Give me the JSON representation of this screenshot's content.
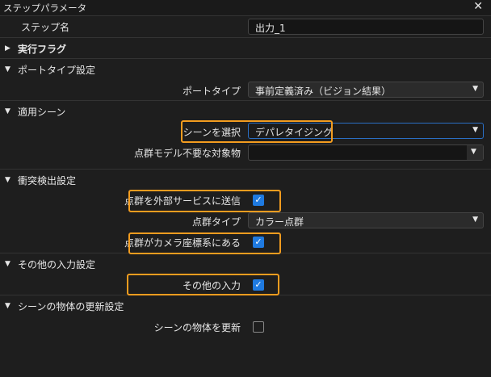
{
  "title": "ステップパラメータ",
  "step_name": {
    "label": "ステップ名",
    "value": "出力_1"
  },
  "exec_flag": "実行フラグ",
  "port_section": {
    "title": "ポートタイプ設定",
    "label": "ポートタイプ",
    "value": "事前定義済み（ビジョン結果）"
  },
  "scene_section": {
    "title": "適用シーン",
    "select_label": "シーンを選択",
    "select_value": "デパレタイジング",
    "unneeded_label": "点群モデル不要な対象物",
    "unneeded_value": ""
  },
  "collision_section": {
    "title": "衝突検出設定",
    "send_label": "点群を外部サービスに送信",
    "send_checked": true,
    "type_label": "点群タイプ",
    "type_value": "カラー点群",
    "camera_label": "点群がカメラ座標系にある",
    "camera_checked": true
  },
  "other_section": {
    "title": "その他の入力設定",
    "label": "その他の入力",
    "checked": true
  },
  "update_section": {
    "title": "シーンの物体の更新設定",
    "label": "シーンの物体を更新",
    "checked": false
  },
  "highlight_color": "#f39c1f"
}
